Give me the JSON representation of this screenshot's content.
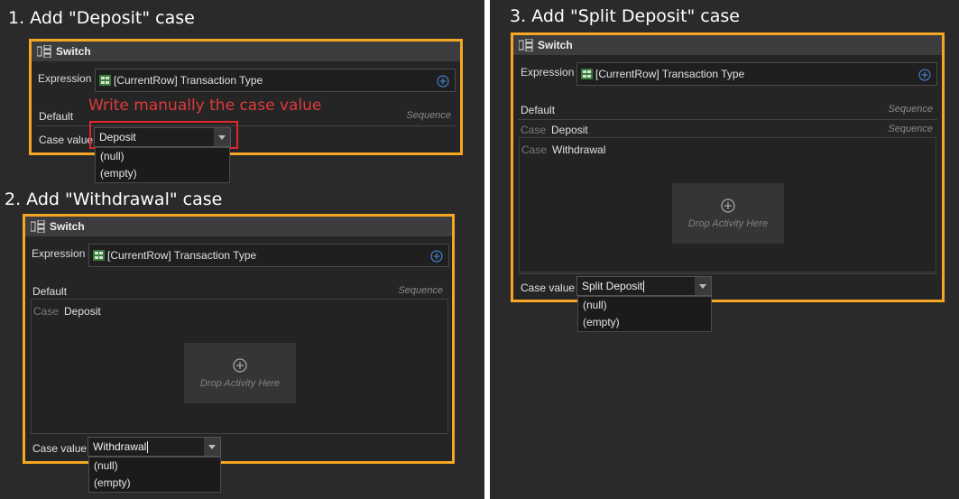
{
  "steps": [
    {
      "title": "1. Add \"Deposit\" case"
    },
    {
      "title": "2. Add \"Withdrawal\" case"
    },
    {
      "title": "3. Add \"Split Deposit\" case"
    }
  ],
  "switch_title": "Switch",
  "expression_label": "Expression",
  "expression_value": "[CurrentRow] Transaction Type",
  "default_label": "Default",
  "sequence_label": "Sequence",
  "case_word": "Case",
  "case_value_label": "Case value",
  "drop_activity": "Drop Activity Here",
  "annotation": "Write manually the case value",
  "panel1": {
    "case_value": "Deposit",
    "options": [
      "(null)",
      "(empty)"
    ]
  },
  "panel2": {
    "cases": [
      "Deposit"
    ],
    "case_value": "Withdrawal",
    "options": [
      "(null)",
      "(empty)"
    ]
  },
  "panel3": {
    "cases": [
      "Deposit",
      "Withdrawal"
    ],
    "case_value": "Split Deposit",
    "options": [
      "(null)",
      "(empty)"
    ]
  },
  "colors": {
    "highlight_box": "#f5a623",
    "annotation_red": "#e03a3a",
    "divider": "#ffffff"
  }
}
